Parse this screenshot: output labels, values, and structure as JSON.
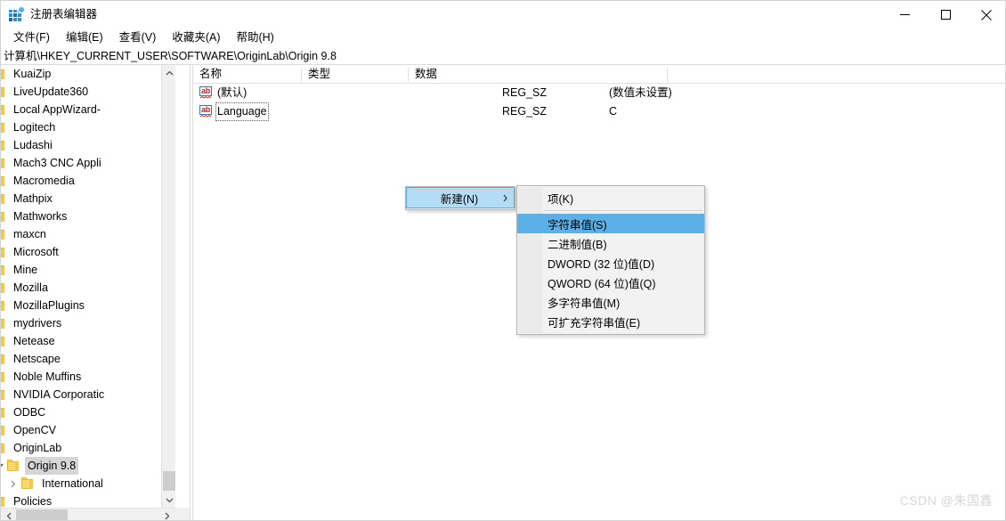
{
  "window": {
    "title": "注册表编辑器",
    "icon": "registry-editor-icon",
    "minimize_label": "最小化",
    "maximize_label": "最大化",
    "close_label": "关闭"
  },
  "menubar": {
    "items": [
      {
        "label": "文件(F)"
      },
      {
        "label": "编辑(E)"
      },
      {
        "label": "查看(V)"
      },
      {
        "label": "收藏夹(A)"
      },
      {
        "label": "帮助(H)"
      }
    ]
  },
  "address": {
    "path": "计算机\\HKEY_CURRENT_USER\\SOFTWARE\\OriginLab\\Origin 9.8"
  },
  "tree": {
    "nodes": [
      {
        "label": "KuaiZip",
        "indent": 1,
        "twisty": "collapsed",
        "selected": false
      },
      {
        "label": "LiveUpdate360",
        "indent": 1,
        "twisty": "none",
        "selected": false
      },
      {
        "label": "Local AppWizard-",
        "indent": 1,
        "twisty": "collapsed",
        "selected": false
      },
      {
        "label": "Logitech",
        "indent": 1,
        "twisty": "collapsed",
        "selected": false
      },
      {
        "label": "Ludashi",
        "indent": 1,
        "twisty": "none",
        "selected": false
      },
      {
        "label": "Mach3 CNC Appli",
        "indent": 1,
        "twisty": "collapsed",
        "selected": false
      },
      {
        "label": "Macromedia",
        "indent": 1,
        "twisty": "collapsed",
        "selected": false
      },
      {
        "label": "Mathpix",
        "indent": 1,
        "twisty": "collapsed",
        "selected": false
      },
      {
        "label": "Mathworks",
        "indent": 1,
        "twisty": "collapsed",
        "selected": false
      },
      {
        "label": "maxcn",
        "indent": 1,
        "twisty": "collapsed",
        "selected": false
      },
      {
        "label": "Microsoft",
        "indent": 1,
        "twisty": "collapsed",
        "selected": false
      },
      {
        "label": "Mine",
        "indent": 1,
        "twisty": "none",
        "selected": false
      },
      {
        "label": "Mozilla",
        "indent": 1,
        "twisty": "collapsed",
        "selected": false
      },
      {
        "label": "MozillaPlugins",
        "indent": 1,
        "twisty": "collapsed",
        "selected": false
      },
      {
        "label": "mydrivers",
        "indent": 1,
        "twisty": "collapsed",
        "selected": false
      },
      {
        "label": "Netease",
        "indent": 1,
        "twisty": "collapsed",
        "selected": false
      },
      {
        "label": "Netscape",
        "indent": 1,
        "twisty": "collapsed",
        "selected": false
      },
      {
        "label": "Noble Muffins",
        "indent": 1,
        "twisty": "collapsed",
        "selected": false
      },
      {
        "label": "NVIDIA Corporatic",
        "indent": 1,
        "twisty": "collapsed",
        "selected": false
      },
      {
        "label": "ODBC",
        "indent": 1,
        "twisty": "collapsed",
        "selected": false
      },
      {
        "label": "OpenCV",
        "indent": 1,
        "twisty": "collapsed",
        "selected": false
      },
      {
        "label": "OriginLab",
        "indent": 1,
        "twisty": "expanded",
        "selected": false
      },
      {
        "label": "Origin 9.8",
        "indent": 2,
        "twisty": "expanded",
        "selected": true
      },
      {
        "label": "International",
        "indent": 3,
        "twisty": "collapsed",
        "selected": false
      },
      {
        "label": "Policies",
        "indent": 1,
        "twisty": "collapsed",
        "selected": false
      }
    ]
  },
  "list": {
    "columns": [
      {
        "label": "名称"
      },
      {
        "label": "类型"
      },
      {
        "label": "数据"
      }
    ],
    "rows": [
      {
        "icon": "string-value-icon",
        "name": "(默认)",
        "type": "REG_SZ",
        "data": "(数值未设置)",
        "focused": false
      },
      {
        "icon": "string-value-icon",
        "name": "Language",
        "type": "REG_SZ",
        "data": "C",
        "focused": true
      }
    ]
  },
  "context_menu": {
    "parent": {
      "label": "新建(N)",
      "has_submenu": true,
      "highlighted": true
    },
    "items": [
      {
        "label": "项(K)",
        "highlighted": false,
        "separator_after": true
      },
      {
        "label": "字符串值(S)",
        "highlighted": true,
        "separator_after": false
      },
      {
        "label": "二进制值(B)",
        "highlighted": false,
        "separator_after": false
      },
      {
        "label": "DWORD (32 位)值(D)",
        "highlighted": false,
        "separator_after": false
      },
      {
        "label": "QWORD (64 位)值(Q)",
        "highlighted": false,
        "separator_after": false
      },
      {
        "label": "多字符串值(M)",
        "highlighted": false,
        "separator_after": false
      },
      {
        "label": "可扩充字符串值(E)",
        "highlighted": false,
        "separator_after": false
      }
    ]
  },
  "watermark": {
    "text": "CSDN @朱国鑫"
  },
  "colors": {
    "menu_highlight": "#5bb0e8",
    "submenu_parent_highlight": "#b5dcf5",
    "tree_selection": "#d6d6d6",
    "folder": "#fcd96a",
    "scrollbar_thumb": "#cdcdcd",
    "watermark": "#d6d6d6"
  }
}
